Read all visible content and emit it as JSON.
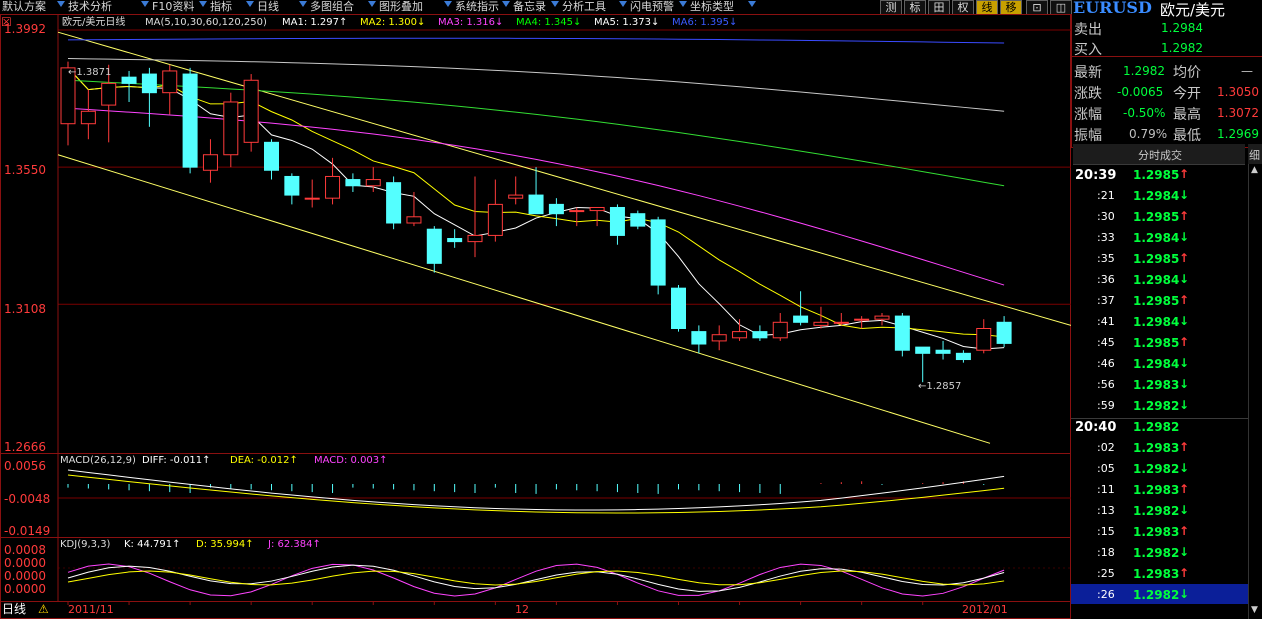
{
  "toolbar": {
    "items": [
      "默认方案",
      "技术分析",
      "F10资料",
      "指标",
      "日线",
      "多图组合",
      "图形叠加",
      "系统指示",
      "备忘录",
      "分析工具",
      "闪电预警",
      "坐标类型"
    ],
    "right_buttons": [
      "测",
      "标",
      "田",
      "权",
      "线",
      "移",
      "⊡",
      "◫"
    ]
  },
  "symbol": {
    "code": "EURUSD",
    "name": "欧元/美元"
  },
  "main_chart": {
    "title": "欧元/美元日线",
    "ma_params": "MA(5,10,30,60,120,250)",
    "ma_labels": [
      {
        "text": "MA1: 1.297↑",
        "color": "#ffffff"
      },
      {
        "text": "MA2: 1.300↓",
        "color": "#ffff00"
      },
      {
        "text": "MA3: 1.316↓",
        "color": "#ff44ff"
      },
      {
        "text": "MA4: 1.345↓",
        "color": "#00ff00"
      },
      {
        "text": "MA5: 1.373↓",
        "color": "#ffffff"
      },
      {
        "text": "MA6: 1.395↓",
        "color": "#3a5bff"
      }
    ],
    "y_ticks": [
      "1.3992",
      "1.3550",
      "1.3108",
      "1.2666"
    ],
    "high_marker": "←1.3871",
    "low_marker": "←1.2857"
  },
  "macd": {
    "title": "MACD(26,12,9)",
    "diff": "DIFF: -0.011↑",
    "dea": "DEA: -0.012↑",
    "macd": "MACD: 0.003↑",
    "y_ticks": [
      "0.0056",
      "-0.0048",
      "-0.0149"
    ]
  },
  "kdj": {
    "title": "KDJ(9,3,3)",
    "k": "K: 44.791↑",
    "d": "D: 35.994↑",
    "j": "J: 62.384↑",
    "y_ticks": [
      "0.0008",
      "0.0000",
      "0.0000",
      "0.0000"
    ]
  },
  "bottom": {
    "period": "日线",
    "x_ticks": [
      "2011/11",
      "12",
      "2012/01"
    ]
  },
  "quote": {
    "sell_label": "卖出",
    "sell": "1.2984",
    "buy_label": "买入",
    "buy": "1.2982",
    "last_label": "最新",
    "last": "1.2982",
    "avg_label": "均价",
    "avg": "—",
    "change_label": "涨跌",
    "change": "-0.0065",
    "open_label": "今开",
    "open": "1.3050",
    "pct_label": "涨幅",
    "pct": "-0.50%",
    "high_label": "最高",
    "high": "1.3072",
    "amp_label": "振幅",
    "amp": "0.79%",
    "low_label": "最低",
    "low": "1.2969",
    "ticks_header": "分时成交",
    "ticks_header_btn": "细"
  },
  "ticks": [
    {
      "time": "20:39",
      "price": "1.2985",
      "dir": "up"
    },
    {
      "time": ":21",
      "price": "1.2984",
      "dir": "down"
    },
    {
      "time": ":30",
      "price": "1.2985",
      "dir": "up"
    },
    {
      "time": ":33",
      "price": "1.2984",
      "dir": "down"
    },
    {
      "time": ":35",
      "price": "1.2985",
      "dir": "up"
    },
    {
      "time": ":36",
      "price": "1.2984",
      "dir": "down"
    },
    {
      "time": ":37",
      "price": "1.2985",
      "dir": "up"
    },
    {
      "time": ":41",
      "price": "1.2984",
      "dir": "down"
    },
    {
      "time": ":45",
      "price": "1.2985",
      "dir": "up"
    },
    {
      "time": ":46",
      "price": "1.2984",
      "dir": "down"
    },
    {
      "time": ":56",
      "price": "1.2983",
      "dir": "down"
    },
    {
      "time": ":59",
      "price": "1.2982",
      "dir": "down"
    },
    {
      "time": "20:40",
      "price": "1.2982",
      "dir": ""
    },
    {
      "time": ":02",
      "price": "1.2983",
      "dir": "up"
    },
    {
      "time": ":05",
      "price": "1.2982",
      "dir": "down"
    },
    {
      "time": ":11",
      "price": "1.2983",
      "dir": "up"
    },
    {
      "time": ":13",
      "price": "1.2982",
      "dir": "down"
    },
    {
      "time": ":15",
      "price": "1.2983",
      "dir": "up"
    },
    {
      "time": ":18",
      "price": "1.2982",
      "dir": "down"
    },
    {
      "time": ":25",
      "price": "1.2983",
      "dir": "up"
    },
    {
      "time": ":26",
      "price": "1.2982",
      "dir": "down"
    }
  ],
  "candles": [
    {
      "o": 1.369,
      "h": 1.389,
      "l": 1.362,
      "c": 1.387
    },
    {
      "o": 1.369,
      "h": 1.38,
      "l": 1.364,
      "c": 1.373
    },
    {
      "o": 1.375,
      "h": 1.388,
      "l": 1.363,
      "c": 1.382
    },
    {
      "o": 1.384,
      "h": 1.386,
      "l": 1.376,
      "c": 1.382
    },
    {
      "o": 1.385,
      "h": 1.387,
      "l": 1.368,
      "c": 1.379
    },
    {
      "o": 1.379,
      "h": 1.388,
      "l": 1.372,
      "c": 1.386
    },
    {
      "o": 1.385,
      "h": 1.387,
      "l": 1.353,
      "c": 1.355
    },
    {
      "o": 1.354,
      "h": 1.364,
      "l": 1.35,
      "c": 1.359
    },
    {
      "o": 1.359,
      "h": 1.379,
      "l": 1.355,
      "c": 1.376
    },
    {
      "o": 1.363,
      "h": 1.385,
      "l": 1.36,
      "c": 1.383
    },
    {
      "o": 1.363,
      "h": 1.364,
      "l": 1.351,
      "c": 1.354
    },
    {
      "o": 1.352,
      "h": 1.353,
      "l": 1.343,
      "c": 1.346
    },
    {
      "o": 1.345,
      "h": 1.351,
      "l": 1.342,
      "c": 1.345
    },
    {
      "o": 1.345,
      "h": 1.358,
      "l": 1.343,
      "c": 1.352
    },
    {
      "o": 1.351,
      "h": 1.353,
      "l": 1.347,
      "c": 1.349
    },
    {
      "o": 1.349,
      "h": 1.355,
      "l": 1.347,
      "c": 1.351
    },
    {
      "o": 1.35,
      "h": 1.352,
      "l": 1.335,
      "c": 1.337
    },
    {
      "o": 1.337,
      "h": 1.347,
      "l": 1.336,
      "c": 1.339
    },
    {
      "o": 1.335,
      "h": 1.336,
      "l": 1.321,
      "c": 1.324
    },
    {
      "o": 1.332,
      "h": 1.335,
      "l": 1.329,
      "c": 1.331
    },
    {
      "o": 1.331,
      "h": 1.352,
      "l": 1.326,
      "c": 1.333
    },
    {
      "o": 1.333,
      "h": 1.351,
      "l": 1.331,
      "c": 1.343
    },
    {
      "o": 1.345,
      "h": 1.352,
      "l": 1.343,
      "c": 1.346
    },
    {
      "o": 1.346,
      "h": 1.355,
      "l": 1.341,
      "c": 1.34
    },
    {
      "o": 1.343,
      "h": 1.345,
      "l": 1.336,
      "c": 1.34
    },
    {
      "o": 1.341,
      "h": 1.342,
      "l": 1.336,
      "c": 1.341
    },
    {
      "o": 1.341,
      "h": 1.342,
      "l": 1.336,
      "c": 1.342
    },
    {
      "o": 1.342,
      "h": 1.343,
      "l": 1.33,
      "c": 1.333
    },
    {
      "o": 1.34,
      "h": 1.341,
      "l": 1.335,
      "c": 1.336
    },
    {
      "o": 1.338,
      "h": 1.339,
      "l": 1.314,
      "c": 1.317
    },
    {
      "o": 1.316,
      "h": 1.317,
      "l": 1.302,
      "c": 1.303
    },
    {
      "o": 1.302,
      "h": 1.304,
      "l": 1.295,
      "c": 1.298
    },
    {
      "o": 1.299,
      "h": 1.304,
      "l": 1.296,
      "c": 1.301
    },
    {
      "o": 1.3,
      "h": 1.306,
      "l": 1.299,
      "c": 1.302
    },
    {
      "o": 1.302,
      "h": 1.304,
      "l": 1.299,
      "c": 1.3
    },
    {
      "o": 1.3,
      "h": 1.308,
      "l": 1.299,
      "c": 1.305
    },
    {
      "o": 1.307,
      "h": 1.315,
      "l": 1.304,
      "c": 1.305
    },
    {
      "o": 1.304,
      "h": 1.31,
      "l": 1.303,
      "c": 1.305
    },
    {
      "o": 1.305,
      "h": 1.308,
      "l": 1.304,
      "c": 1.305
    },
    {
      "o": 1.306,
      "h": 1.307,
      "l": 1.303,
      "c": 1.306
    },
    {
      "o": 1.306,
      "h": 1.308,
      "l": 1.304,
      "c": 1.307
    },
    {
      "o": 1.307,
      "h": 1.308,
      "l": 1.294,
      "c": 1.296
    },
    {
      "o": 1.297,
      "h": 1.297,
      "l": 1.2857,
      "c": 1.295
    },
    {
      "o": 1.296,
      "h": 1.299,
      "l": 1.293,
      "c": 1.295
    },
    {
      "o": 1.295,
      "h": 1.296,
      "l": 1.292,
      "c": 1.293
    },
    {
      "o": 1.296,
      "h": 1.306,
      "l": 1.295,
      "c": 1.303
    },
    {
      "o": 1.305,
      "h": 1.307,
      "l": 1.297,
      "c": 1.2982
    }
  ],
  "colors": {
    "up": "#ff3b3b",
    "down": "#54ffff",
    "frame": "#8a1010",
    "grid": "#7a0000",
    "trend": "#ffff66",
    "ma_white": "#ffffff",
    "ma_yellow": "#ffff00",
    "ma_magenta": "#ff44ff",
    "ma_green": "#33dd33",
    "ma_gray": "#c8c8c8",
    "ma_blue": "#3a4bff"
  }
}
